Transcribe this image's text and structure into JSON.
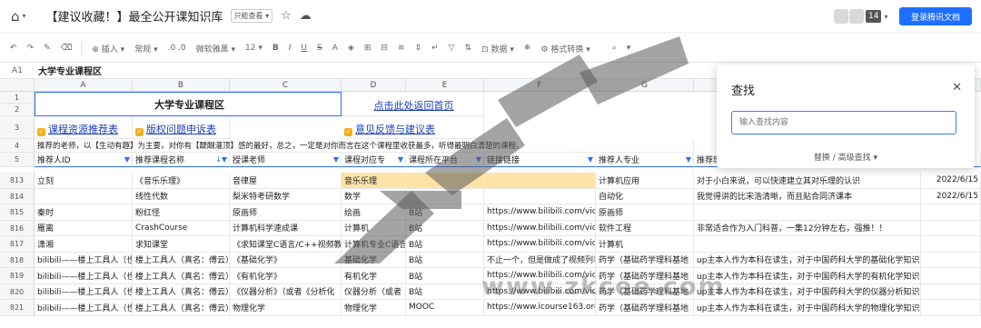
{
  "header": {
    "home_icon": "home-icon",
    "doc_title": "【建议收藏！】最全公开课知识库",
    "readonly_badge": "只能查看",
    "avatar_count": "14",
    "login_button": "登录腾讯文档"
  },
  "toolbar": {
    "insert": "插入",
    "format": "常规",
    "decimal": ".0",
    "font": "微软雅黑",
    "font_size": "12",
    "data": "数据",
    "format_convert": "格式转换"
  },
  "formula_bar": {
    "cell_ref": "A1",
    "value": "大学专业课程区"
  },
  "columns": [
    "A",
    "B",
    "C",
    "D",
    "E",
    "F",
    "G",
    "H"
  ],
  "top_rows": {
    "row1_2_title": "大学专业课程区",
    "row1_2_link": "点击此处返回首页",
    "row3_a": "课程资源推荐表",
    "row3_b": "版权问题申诉表",
    "row3_d": "意见反馈与建议表",
    "row4_text": "推荐的老师，以【生动有趣】为主要，对你有【醍醐灌顶】感的最好，总之，一定是对你而言在这个课程里收获最多，听得最明白清楚的课程。"
  },
  "headers": [
    "推荐人ID",
    "推荐课程名称",
    "授课老师",
    "课程对应专",
    "课程所在平台",
    "链接链接",
    "推荐人专业",
    "推荐理由"
  ],
  "row_numbers": {
    "r1": "1",
    "r2": "2",
    "r3": "3",
    "r4": "4",
    "r5": "5"
  },
  "rows": [
    {
      "n": "813",
      "a": "立刻",
      "b": "《音乐乐理》",
      "c": "音律屋",
      "d": "音乐乐理",
      "e": "",
      "f": "",
      "g": "计算机应用",
      "h": "对于小白来说，可以快速建立其对乐理的认识",
      "i": "2022/6/15"
    },
    {
      "n": "814",
      "a": "",
      "b": "线性代数",
      "c": "梨米特考研数学",
      "d": "数学",
      "e": "",
      "f": "",
      "g": "自动化",
      "h": "我觉得讲的比宋浩清晰，而且贴合同济课本",
      "i": "2022/6/15"
    },
    {
      "n": "815",
      "a": "秦时",
      "b": "粉红怪",
      "c": "原画师",
      "d": "绘画",
      "e": "B站",
      "f": "https://www.bilibili.com/video/",
      "g": "原画师",
      "h": "",
      "i": ""
    },
    {
      "n": "816",
      "a": "雁离",
      "b": "CrashCourse",
      "c": "计算机科学速成课",
      "d": "计算机",
      "e": "B站",
      "f": "https://www.bilibili.com/video/",
      "g": "软件工程",
      "h": "非常适合作为入门科普，一集12分钟左右，强推！！",
      "i": ""
    },
    {
      "n": "817",
      "a": "潇湘",
      "b": "求知课堂",
      "c": "《求知课堂C语言/C++视频教程》",
      "d": "计算机专业C语言",
      "e": "B站",
      "f": "https://www.bilibili.com/video/",
      "g": "计算机",
      "h": "",
      "i": ""
    },
    {
      "n": "818",
      "a": "bilibili——楼上工具人（也",
      "b": "楼上工具人（真名：傅云）",
      "c": "《基础化学》",
      "d": "基础化学",
      "e": "B站",
      "f": "不止一个，但是做成了视频列表",
      "g": "药学（基础药学理科基地",
      "h": "up主本人作为本科在读生，对于中国药科大学的基础化学知识点进行了比较",
      "i": ""
    },
    {
      "n": "819",
      "a": "bilibili——楼上工具人（也",
      "b": "楼上工具人（真名：傅云）",
      "c": "《有机化学》",
      "d": "有机化学",
      "e": "B站",
      "f": "https://www.bilibili.com/video/",
      "g": "药学（基础药学理科基地",
      "h": "up主本人作为本科在读生，对于中国药科大学的有机化学知识点、考研、历",
      "i": ""
    },
    {
      "n": "820",
      "a": "bilibili——楼上工具人（也",
      "b": "楼上工具人（真名：傅云）",
      "c": "《仪器分析》（或者《分析化",
      "d": "仪器分析（或者",
      "e": "B站",
      "f": "https://www.bilibili.com/video/",
      "g": "药学（基础药学理科基地",
      "h": "up主本人作为本科在读生，对于中国药科大学的仪器分析知识点进行了研究",
      "i": ""
    },
    {
      "n": "821",
      "a": "bilibili——楼上工具人（也",
      "b": "楼上工具人（真名：傅云）",
      "c": "物理化学",
      "d": "物理化学",
      "e": "MOOC",
      "f": "https://www.icourse163.org/c",
      "g": "药学（基础药学理科基地",
      "h": "up主本人作为本科在读生，对于中国药科大学的物理化学知识点进行了研究",
      "i": ""
    }
  ],
  "find_dialog": {
    "title": "查找",
    "placeholder": "输入查找内容",
    "advanced": "替换 / 高级查找"
  },
  "watermark": {
    "text": "www.zkcee.com"
  },
  "colors": {
    "accent": "#1e6fff",
    "highlight": "#fde3a7",
    "selection": "#2b6fff"
  }
}
